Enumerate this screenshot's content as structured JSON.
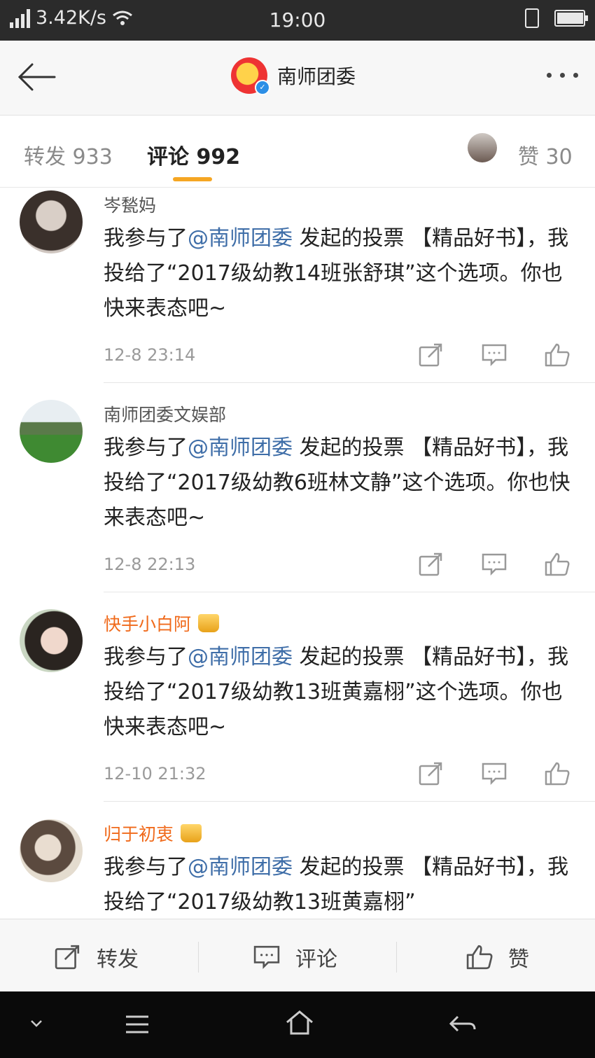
{
  "status_bar": {
    "net_speed": "3.42K/s",
    "time": "19:00"
  },
  "header": {
    "account_name": "南师团委"
  },
  "tabs": {
    "repost": "转发 933",
    "comment": "评论 992",
    "like": "赞 30"
  },
  "comments": [
    {
      "name": "岑甃妈",
      "vip": false,
      "text_before": "我参与了",
      "mention": "@南师团委",
      "text_after": " 发起的投票 【精品好书】，我投给了“2017级幼教14班张舒琪”这个选项。你也快来表态吧~",
      "time": "12-8 23:14"
    },
    {
      "name": "南师团委文娱部",
      "vip": false,
      "text_before": "我参与了",
      "mention": "@南师团委",
      "text_after": " 发起的投票 【精品好书】，我投给了“2017级幼教6班林文静”这个选项。你也快来表态吧~",
      "time": "12-8 22:13"
    },
    {
      "name": "快手小白阿",
      "vip": true,
      "text_before": "我参与了",
      "mention": "@南师团委",
      "text_after": " 发起的投票 【精品好书】，我投给了“2017级幼教13班黄嘉栩”这个选项。你也快来表态吧~",
      "time": "12-10 21:32"
    },
    {
      "name": "归于初衷",
      "vip": true,
      "text_before": "我参与了",
      "mention": "@南师团委",
      "text_after": " 发起的投票 【精品好书】，我投给了“2017级幼教13班黄嘉栩”",
      "time": ""
    }
  ],
  "bottom_bar": {
    "repost": "转发",
    "comment": "评论",
    "like": "赞"
  },
  "colors": {
    "accent": "#f5a623",
    "mention": "#3f6ea8",
    "vip_name": "#f06a1b"
  }
}
